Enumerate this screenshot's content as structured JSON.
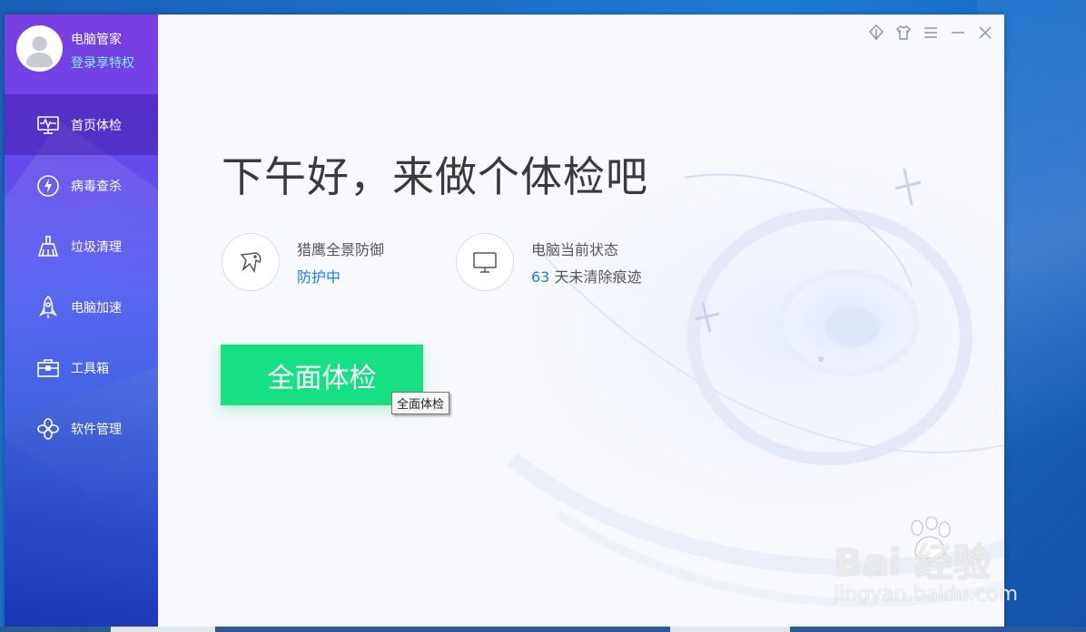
{
  "app": {
    "name": "电脑管家",
    "login_text": "登录享特权"
  },
  "nav": {
    "items": [
      {
        "label": "首页体检",
        "icon": "monitor-pulse-icon",
        "active": true
      },
      {
        "label": "病毒查杀",
        "icon": "lightning-shield-icon",
        "active": false
      },
      {
        "label": "垃圾清理",
        "icon": "broom-icon",
        "active": false
      },
      {
        "label": "电脑加速",
        "icon": "rocket-icon",
        "active": false
      },
      {
        "label": "工具箱",
        "icon": "toolbox-icon",
        "active": false
      },
      {
        "label": "软件管理",
        "icon": "software-clover-icon",
        "active": false
      }
    ]
  },
  "window_controls": [
    "skin-leaf-icon",
    "tshirt-icon",
    "menu-icon",
    "minimize-icon",
    "close-icon"
  ],
  "main": {
    "greeting": "下午好，来做个体检吧",
    "protection": {
      "label": "猎鹰全景防御",
      "value": "防护中"
    },
    "pc_status": {
      "label": "电脑当前状态",
      "days": "63",
      "suffix": "天未清除痕迹"
    },
    "scan_button": "全面体检",
    "tooltip": "全面体检"
  },
  "watermark": {
    "brand": "Bai 经验",
    "url": "jingyan.baidu.com"
  },
  "colors": {
    "accent_green": "#17e082",
    "accent_blue": "#1b7fe6",
    "sidebar_top": "#7b3fe0",
    "sidebar_bottom": "#1f3cc4"
  }
}
